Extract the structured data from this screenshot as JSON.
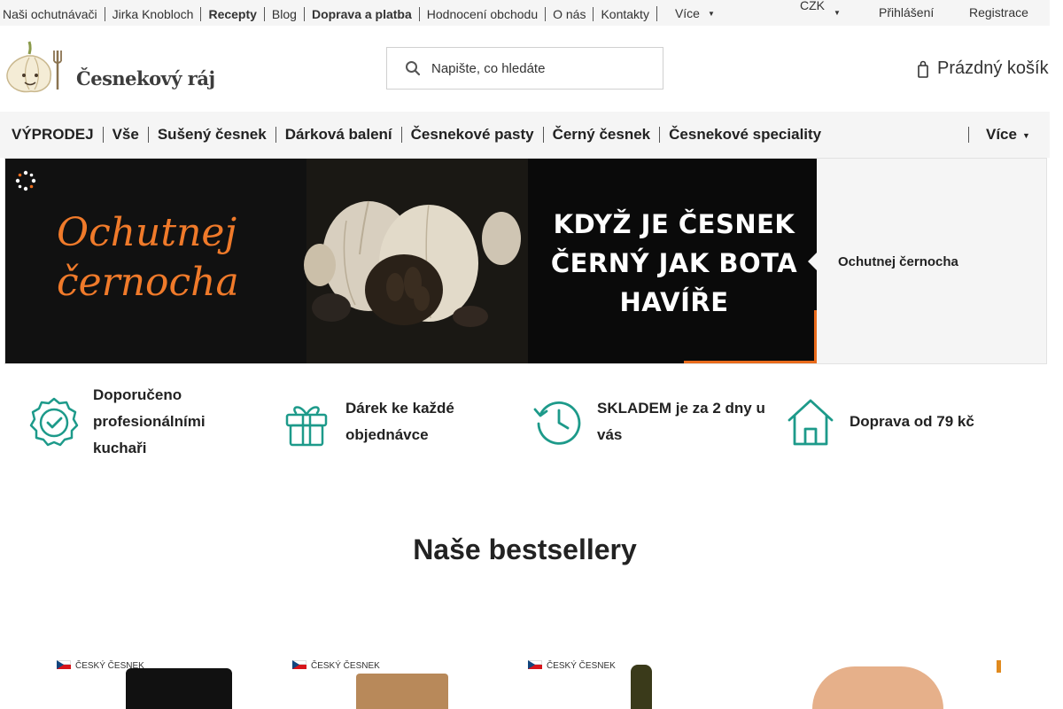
{
  "topbar": {
    "links": [
      "Naši ochutnávači",
      "Jirka Knobloch",
      "Recepty",
      "Blog",
      "Doprava a platba",
      "Hodnocení obchodu",
      "O nás",
      "Kontakty"
    ],
    "more": "Více",
    "currency": "CZK",
    "login": "Přihlášení",
    "register": "Registrace"
  },
  "header": {
    "logo_text": "Česnekový ráj",
    "search_placeholder": "Napište, co hledáte",
    "cart_label": "Prázdný košík"
  },
  "categories": {
    "items": [
      "VÝPRODEJ",
      "Vše",
      "Sušený česnek",
      "Dárková balení",
      "Česnekové pasty",
      "Černý česnek",
      "Česnekové speciality"
    ],
    "more": "Více"
  },
  "hero": {
    "left_title": "Ochutnej černocha",
    "right_text": "KDYŽ JE ČESNEK ČERNÝ JAK BOTA HAVÍŘE",
    "caption": "Ochutnej černocha"
  },
  "benefits": [
    {
      "text": "Doporučeno profesionálními kuchaři",
      "icon": "badge-check-icon"
    },
    {
      "text": "Dárek ke každé objednávce",
      "icon": "gift-icon"
    },
    {
      "text": "SKLADEM je za 2 dny u vás",
      "icon": "clock-icon"
    },
    {
      "text": "Doprava od 79 kč",
      "icon": "house-icon"
    }
  ],
  "bestsellers": {
    "title": "Naše bestsellery",
    "products": [
      {
        "badge": "Český česnek"
      },
      {
        "badge": "Český česnek"
      },
      {
        "badge": "Český česnek"
      },
      {
        "badge": ""
      },
      {
        "badge": ""
      }
    ]
  },
  "colors": {
    "accent": "#1d9a8a",
    "orange": "#f07a2a",
    "nav_bg": "#f5f5f5"
  }
}
